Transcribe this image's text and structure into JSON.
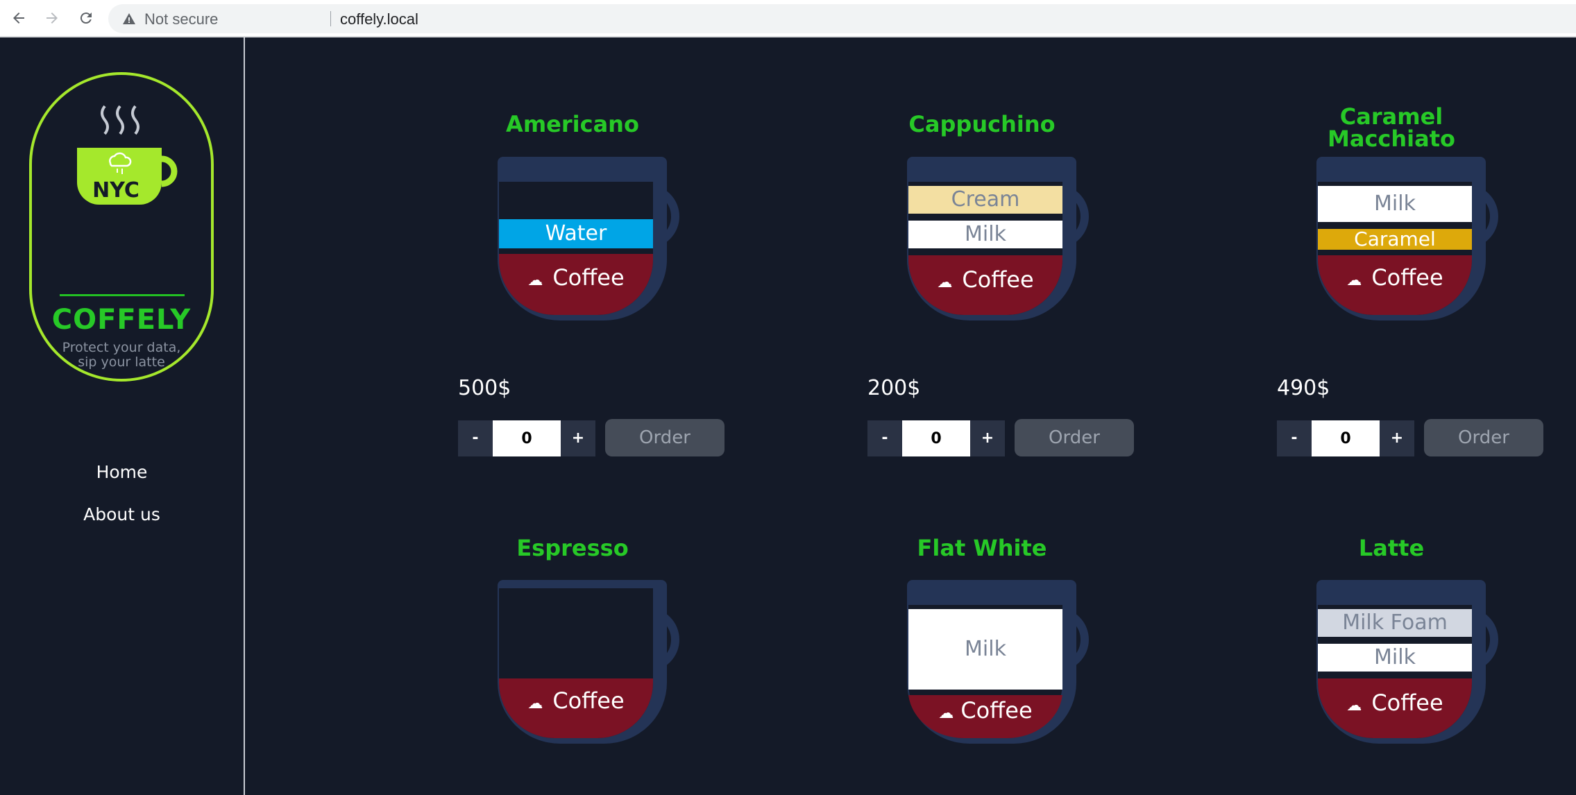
{
  "browser": {
    "security_text": "Not secure",
    "url": "coffely.local"
  },
  "sidebar": {
    "logo_text": "NYC",
    "brand": "COFFELY",
    "tagline_line1": "Protect your data,",
    "tagline_line2": "sip your latte",
    "menu": [
      {
        "label": "Home"
      },
      {
        "label": "About us"
      }
    ]
  },
  "colors": {
    "accent_green": "#27c927",
    "badge_green": "#a5e82c",
    "background": "#141a28",
    "coffee": "#7b1224",
    "water": "#00a5e6",
    "cream": "#f3dfa2",
    "caramel": "#dda90b",
    "milk": "#ffffff",
    "milk_foam": "#d2d7e1",
    "cup_outline": "#243456"
  },
  "products": [
    {
      "name": "Americano",
      "price": "500$",
      "quantity": "0",
      "minus": "-",
      "plus": "+",
      "order": "Order",
      "layers": [
        "Water",
        "Coffee"
      ]
    },
    {
      "name": "Cappuchino",
      "price": "200$",
      "quantity": "0",
      "minus": "-",
      "plus": "+",
      "order": "Order",
      "layers": [
        "Cream",
        "Milk",
        "Coffee"
      ]
    },
    {
      "name": "Caramel Macchiato",
      "name_line1": "Caramel",
      "name_line2": "Macchiato",
      "price": "490$",
      "quantity": "0",
      "minus": "-",
      "plus": "+",
      "order": "Order",
      "layers": [
        "Milk",
        "Caramel",
        "Coffee"
      ]
    },
    {
      "name": "Espresso",
      "layers": [
        "Coffee"
      ]
    },
    {
      "name": "Flat White",
      "layers": [
        "Milk",
        "Coffee"
      ]
    },
    {
      "name": "Latte",
      "layers": [
        "Milk Foam",
        "Milk",
        "Coffee"
      ]
    }
  ]
}
